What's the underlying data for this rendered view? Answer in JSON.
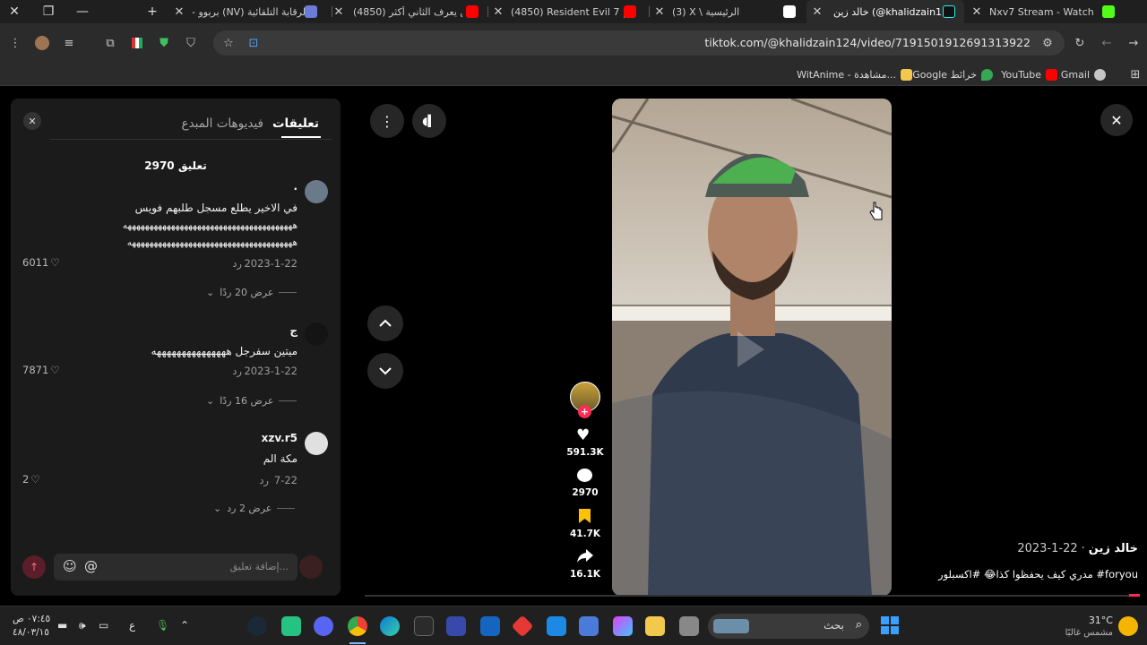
{
  "browser": {
    "tabs": [
      {
        "title": "- بربوو (NV) الرقابة التلقائية",
        "favicon_color": "#6a7bd8"
      },
      {
        "title": "(4850) مين يعرف الثاني أكثر",
        "favicon_color": "#ff0000"
      },
      {
        "title": "(4850) Resident Evil 7 | عائلة",
        "favicon_color": "#ff0000"
      },
      {
        "title": "(3) X \\ الرئيسية",
        "favicon_color": "#ffffff"
      },
      {
        "title": "خالد زين (@khalidzain124)",
        "favicon_color": "#25f4ee",
        "active": true
      },
      {
        "title": "Nxv7 Stream - Watch Live",
        "favicon_color": "#53fc18"
      }
    ],
    "url": "tiktok.com/@khalidzain124/video/7191501912691313922",
    "bookmarks": [
      {
        "label": "Gmail",
        "favicon_color": "#c5c5c5"
      },
      {
        "label": "YouTube",
        "favicon_color": "#ff0000"
      },
      {
        "label": "Google خرائط",
        "favicon_color": "#34a853"
      },
      {
        "label": "WitAnime - مشاهدة...",
        "favicon_color": "#f2c94c"
      }
    ]
  },
  "panel": {
    "tab_comments": "تعليقات",
    "tab_creator_videos": "فيديوهات المبدع",
    "comment_count_label": "2970 تعليق",
    "comments": [
      {
        "username": ".",
        "lines": [
          "في الاخير يطلع مسجل طلبهم فويس",
          "هههههههههههههههههههههههههههههههههههههههه",
          "ههههههههههههههههههههههههههههههههههههههه"
        ],
        "date": "2023-1-22",
        "reply": "رد",
        "likes": "6011",
        "view_replies": "عرض 20 ردًا"
      },
      {
        "username": "ج",
        "lines": [
          "ميتين سفرجل هههههههههههههههه"
        ],
        "date": "2023-1-22",
        "reply": "رد",
        "likes": "7871",
        "view_replies": "عرض 16 ردًا"
      },
      {
        "username": "xzv.r5",
        "lines": [
          "مكة الم"
        ],
        "date": "7-22",
        "reply": "رد",
        "likes": "2",
        "view_replies": "عرض 2 رد"
      }
    ],
    "input_placeholder": "إضافة تعليق...",
    "mention_symbol": "@"
  },
  "video": {
    "likes": "591.3K",
    "comments": "2970",
    "saves": "41.7K",
    "shares": "16.1K",
    "author": "خالد زين",
    "date": "2023-1-22",
    "separator": "·",
    "caption": "مدري كيف يحفظوا كذا😂 #اكسبلور #foryou"
  },
  "taskbar": {
    "weather_temp": "31°C",
    "weather_desc": "مشمس غالبًا",
    "search_label": "بحث",
    "time": "٠٧:٤٥ ص",
    "date": "٤٨/٠٣/١٥",
    "lang": "ع"
  },
  "colors": {
    "accent": "#fe2c55",
    "panel_bg": "#1b1b1b",
    "bookmark_yellow": "#ffc107"
  }
}
